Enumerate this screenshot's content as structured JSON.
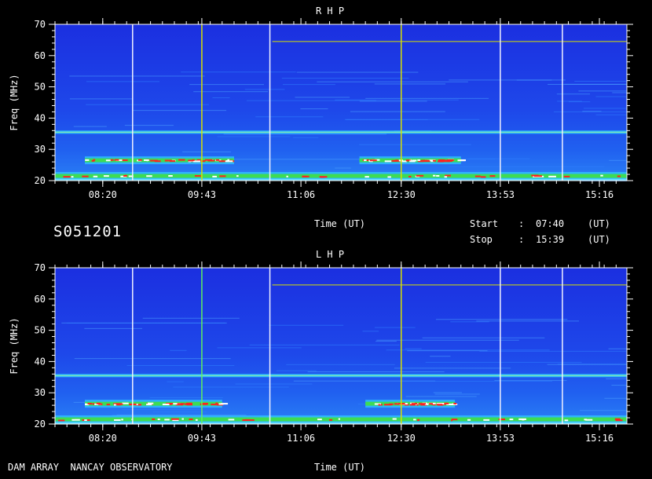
{
  "observation_id": "S051201",
  "observatory": "DAM ARRAY  NANCAY OBSERVATORY",
  "time_axis_label": "Time (UT)",
  "start_label": "Start",
  "stop_label": "Stop",
  "colon": ":",
  "start_time": "07:40",
  "stop_time": "15:39",
  "ut_label": "(UT)",
  "colors": {
    "background": "#000000",
    "spectrum_base": "#1a3fe6",
    "band_cyan": "#1ec8ff",
    "band_green": "#30e040",
    "burst_red": "#ff2020",
    "burst_white": "#ffffff",
    "line_yellow": "#e8e800",
    "line_green": "#80ff80"
  },
  "chart_data": [
    {
      "type": "heatmap",
      "title": "R H P",
      "polarization": "RHP",
      "xlabel": "Time (UT)",
      "ylabel": "Freq (MHz)",
      "xlim": [
        "07:40",
        "15:39"
      ],
      "ylim": [
        20,
        70
      ],
      "x_ticks": [
        "08:20",
        "09:43",
        "11:06",
        "12:30",
        "13:53",
        "15:16"
      ],
      "y_ticks": [
        20,
        30,
        40,
        50,
        60,
        70
      ],
      "vertical_lines": [
        {
          "time": "08:45",
          "color": "white"
        },
        {
          "time": "09:43",
          "color": "yellow"
        },
        {
          "time": "10:40",
          "color": "white"
        },
        {
          "time": "12:30",
          "color": "yellow"
        },
        {
          "time": "13:53",
          "color": "white"
        },
        {
          "time": "14:45",
          "color": "white"
        }
      ],
      "horizontal_lines": [
        {
          "freq": 64.5,
          "from": "10:42",
          "to": "15:39",
          "color": "yellow"
        }
      ],
      "bands": [
        {
          "freq": 35.5,
          "from": "07:40",
          "to": "15:39",
          "intensity": "cyan"
        },
        {
          "freq": 26.5,
          "from": "08:05",
          "to": "10:10",
          "intensity": "burst"
        },
        {
          "freq": 26.5,
          "from": "11:55",
          "to": "13:20",
          "intensity": "burst"
        },
        {
          "freq": 21.5,
          "from": "07:40",
          "to": "15:39",
          "intensity": "burst"
        }
      ]
    },
    {
      "type": "heatmap",
      "title": "L H P",
      "polarization": "LHP",
      "xlabel": "Time (UT)",
      "ylabel": "Freq (MHz)",
      "xlim": [
        "07:40",
        "15:39"
      ],
      "ylim": [
        20,
        70
      ],
      "x_ticks": [
        "08:20",
        "09:43",
        "11:06",
        "12:30",
        "13:53",
        "15:16"
      ],
      "y_ticks": [
        20,
        30,
        40,
        50,
        60,
        70
      ],
      "vertical_lines": [
        {
          "time": "08:45",
          "color": "white"
        },
        {
          "time": "09:43",
          "color": "green"
        },
        {
          "time": "10:40",
          "color": "white"
        },
        {
          "time": "12:30",
          "color": "yellow"
        },
        {
          "time": "13:53",
          "color": "white"
        },
        {
          "time": "14:45",
          "color": "white"
        }
      ],
      "horizontal_lines": [
        {
          "freq": 64.5,
          "from": "10:42",
          "to": "15:39",
          "color": "yellow"
        }
      ],
      "bands": [
        {
          "freq": 35.5,
          "from": "07:40",
          "to": "15:39",
          "intensity": "cyan"
        },
        {
          "freq": 26.5,
          "from": "08:05",
          "to": "10:00",
          "intensity": "burst"
        },
        {
          "freq": 26.5,
          "from": "12:00",
          "to": "13:15",
          "intensity": "burst"
        },
        {
          "freq": 21.5,
          "from": "07:40",
          "to": "15:39",
          "intensity": "burst"
        }
      ]
    }
  ]
}
